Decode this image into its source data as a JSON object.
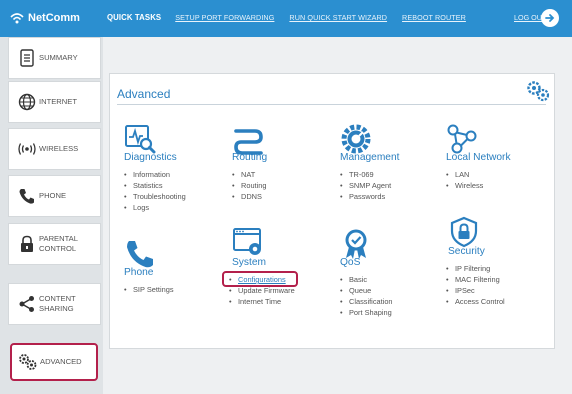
{
  "brand": {
    "name": "NetComm"
  },
  "topnav": {
    "quick_tasks": "QUICK TASKS",
    "links": [
      "SETUP PORT FORWARDING",
      "RUN QUICK START WIZARD",
      "REBOOT ROUTER"
    ],
    "logout": "LOG OUT"
  },
  "sidebar": {
    "items": [
      {
        "label": "SUMMARY",
        "icon": "document-icon"
      },
      {
        "label": "INTERNET",
        "icon": "globe-icon"
      },
      {
        "label": "WIRELESS",
        "icon": "wireless-icon"
      },
      {
        "label": "PHONE",
        "icon": "phone-icon"
      },
      {
        "label_line1": "PARENTAL",
        "label_line2": "CONTROL",
        "icon": "lock-icon"
      },
      {
        "label_line1": "CONTENT",
        "label_line2": "SHARING",
        "icon": "share-icon"
      },
      {
        "label": "ADVANCED",
        "icon": "gears-icon",
        "active": true
      }
    ]
  },
  "main": {
    "title": "Advanced",
    "categories": [
      {
        "title": "Diagnostics",
        "icon": "diagnostics-icon",
        "items": [
          "Information",
          "Statistics",
          "Troubleshooting",
          "Logs"
        ]
      },
      {
        "title": "Routing",
        "icon": "routing-icon",
        "items": [
          "NAT",
          "Routing",
          "DDNS"
        ]
      },
      {
        "title": "Management",
        "icon": "management-gear-icon",
        "items": [
          "TR-069",
          "SNMP Agent",
          "Passwords"
        ]
      },
      {
        "title": "Local Network",
        "icon": "local-network-icon",
        "items": [
          "LAN",
          "Wireless"
        ]
      },
      {
        "title": "Phone",
        "icon": "phone-handset-icon",
        "items": [
          "SIP Settings"
        ]
      },
      {
        "title": "System",
        "icon": "system-window-icon",
        "items": [
          "Configurations",
          "Update Firmware",
          "Internet Time"
        ]
      },
      {
        "title": "QoS",
        "icon": "qos-badge-icon",
        "items": [
          "Basic",
          "Queue",
          "Classification",
          "Port Shaping"
        ]
      },
      {
        "title": "Security",
        "icon": "security-shield-icon",
        "items": [
          "IP Filtering",
          "MAC Filtering",
          "IPSec",
          "Access Control"
        ]
      }
    ]
  },
  "colors": {
    "header": "#2b8fd0",
    "accent": "#2b7fbf",
    "highlight": "#b3204b",
    "sidebar": "#dfe3e6",
    "content": "#eef0f2"
  }
}
